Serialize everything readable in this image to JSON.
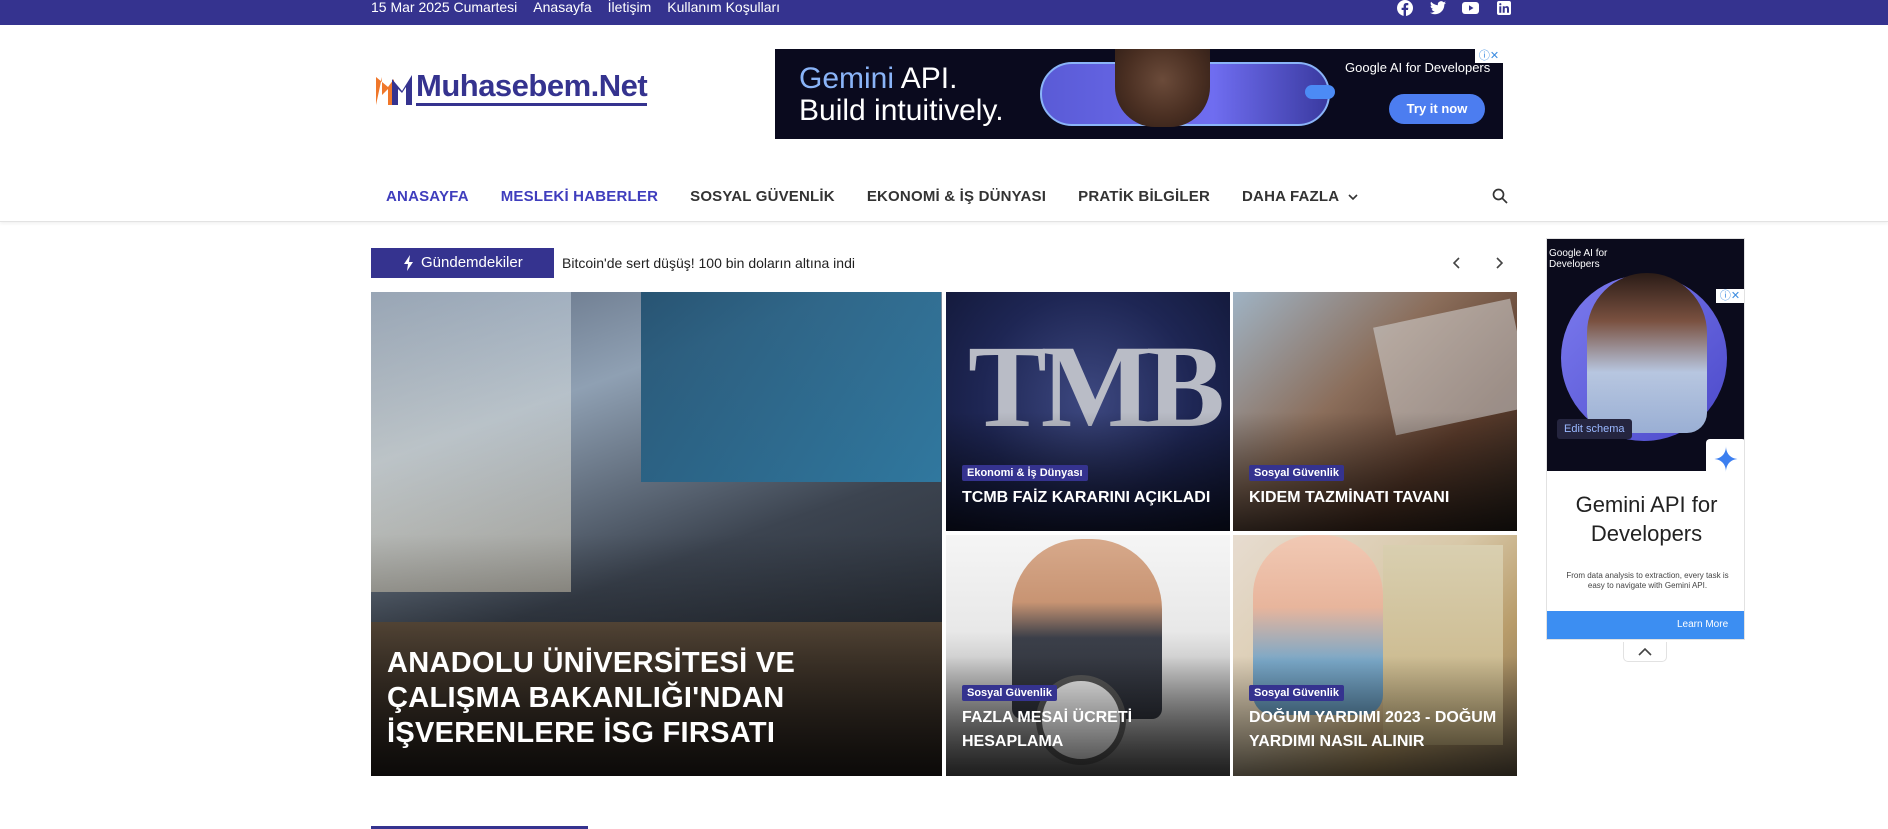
{
  "topbar": {
    "date": "15 Mar 2025 Cumartesi",
    "links": [
      "Anasayfa",
      "İletişim",
      "Kullanım Koşulları"
    ],
    "social_icons": [
      "facebook-icon",
      "twitter-icon",
      "youtube-icon",
      "linkedin-icon"
    ]
  },
  "logo": {
    "text": "Muhasebem.Net"
  },
  "ad_top": {
    "line1_brand": "Gemini",
    "line1_rest": " API.",
    "line2": "Build intuitively.",
    "label": "Google AI for Developers",
    "cta": "Try it now"
  },
  "nav": {
    "items": [
      "ANASAYFA",
      "MESLEKİ HABERLER",
      "SOSYAL GÜVENLİK",
      "EKONOMİ & İŞ DÜNYASI",
      "PRATİK BİLGİLER",
      "DAHA FAZLA"
    ]
  },
  "ticker": {
    "label": "Gündemdekiler",
    "text": "Bitcoin'de sert düşüş! 100 bin doların altına indi"
  },
  "featured": {
    "main": {
      "title": "ANADOLU ÜNİVERSİTESİ VE ÇALIŞMA BAKANLIĞI'NDAN İŞVERENLERE İSG FIRSATI"
    },
    "tcmb": {
      "category": "Ekonomi & İş Dünyası",
      "title": "TCMB FAİZ KARARINI AÇIKLADI"
    },
    "kidem": {
      "category": "Sosyal Güvenlik",
      "title": "KIDEM TAZMİNATI TAVANI"
    },
    "mesai": {
      "category": "Sosyal Güvenlik",
      "title": "FAZLA MESAİ ÜCRETİ HESAPLAMA"
    },
    "dogum": {
      "category": "Sosyal Güvenlik",
      "title": "DOĞUM YARDIMI 2023 - DOĞUM YARDIMI NASIL ALINIR"
    }
  },
  "ad_side": {
    "label": "Google AI for Developers",
    "edit": "Edit schema",
    "heading": "Gemini API for Developers",
    "body": "From data analysis to extraction, every task is easy to navigate with Gemini API.",
    "cta": "Learn More"
  },
  "colors": {
    "brand": "#35338f",
    "accent": "#3f3dbd"
  }
}
